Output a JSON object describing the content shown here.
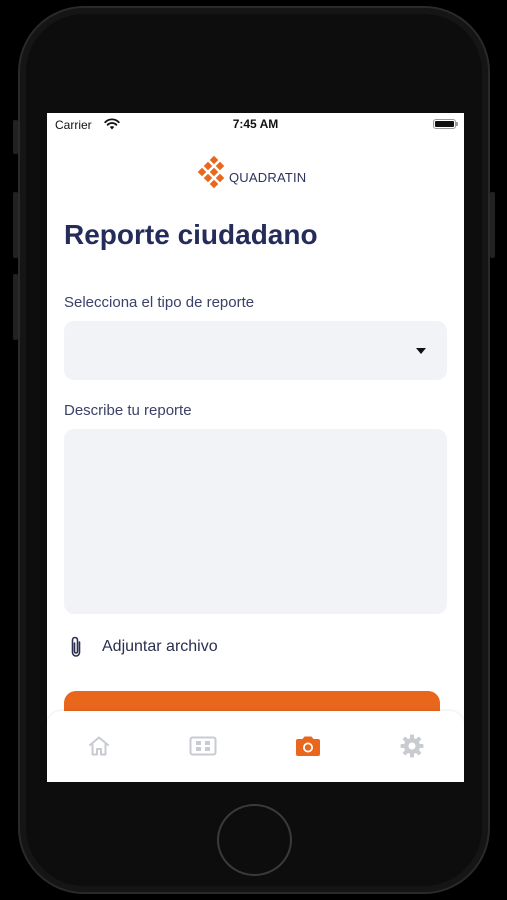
{
  "status_bar": {
    "carrier": "Carrier",
    "time": "7:45 AM"
  },
  "logo": {
    "text": "QUADRATIN",
    "color": "#e8671d"
  },
  "form": {
    "title": "Reporte ciudadano",
    "type_label": "Selecciona el tipo de reporte",
    "type_value": "",
    "description_label": "Describe tu reporte",
    "description_value": "",
    "attach_label": "Adjuntar archivo",
    "submit_color": "#e8671d"
  },
  "tab_bar": {
    "tabs": [
      {
        "icon": "home-icon",
        "active": false
      },
      {
        "icon": "grid-icon",
        "active": false
      },
      {
        "icon": "camera-icon",
        "active": true
      },
      {
        "icon": "gear-icon",
        "active": false
      }
    ],
    "active_color": "#e8671d",
    "inactive_color": "#c9cbd3"
  }
}
